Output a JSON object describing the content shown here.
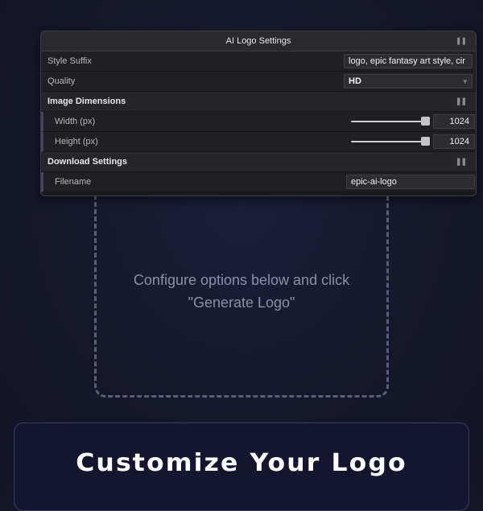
{
  "panel": {
    "title": "AI Logo Settings",
    "style_suffix": {
      "label": "Style Suffix",
      "value": "logo, epic fantasy art style, cir"
    },
    "quality": {
      "label": "Quality",
      "value": "HD"
    },
    "image_dimensions": {
      "title": "Image Dimensions",
      "width": {
        "label": "Width (px)",
        "value": "1024",
        "level": 1.0
      },
      "height": {
        "label": "Height (px)",
        "value": "1024",
        "level": 1.0
      }
    },
    "download": {
      "title": "Download Settings",
      "filename": {
        "label": "Filename",
        "value": "epic-ai-logo"
      }
    }
  },
  "preview": {
    "placeholder": "Configure options below and click \"Generate Logo\""
  },
  "card": {
    "title": "Customize Your Logo"
  },
  "icons": {
    "collapse": "grip-icon",
    "dropdown": "chevron-down-icon"
  },
  "colors": {
    "background": "#15172b",
    "panel": "#1b1b1e",
    "dashed_border": "#5a5c78"
  }
}
